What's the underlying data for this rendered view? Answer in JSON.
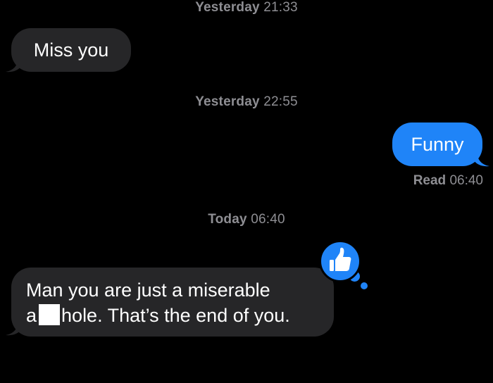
{
  "thread": {
    "timestamp_1": {
      "day": "Yesterday",
      "time": "21:33"
    },
    "message_1": "Miss you",
    "timestamp_2": {
      "day": "Yesterday",
      "time": "22:55"
    },
    "message_2": "Funny",
    "read_receipt": {
      "label": "Read",
      "time": "06:40"
    },
    "timestamp_3": {
      "day": "Today",
      "time": "06:40"
    },
    "message_3": {
      "line_1": "Man you are just a miserable",
      "line_2_start": "a",
      "line_2_end": "hole. That’s the end of you."
    },
    "tapback": "thumbs-up-icon"
  },
  "colors": {
    "background": "#000000",
    "incoming_bubble": "#262628",
    "outgoing_bubble": "#1f84f8",
    "timestamp_text": "#8e8e93",
    "tapback": "#1f84f8"
  }
}
